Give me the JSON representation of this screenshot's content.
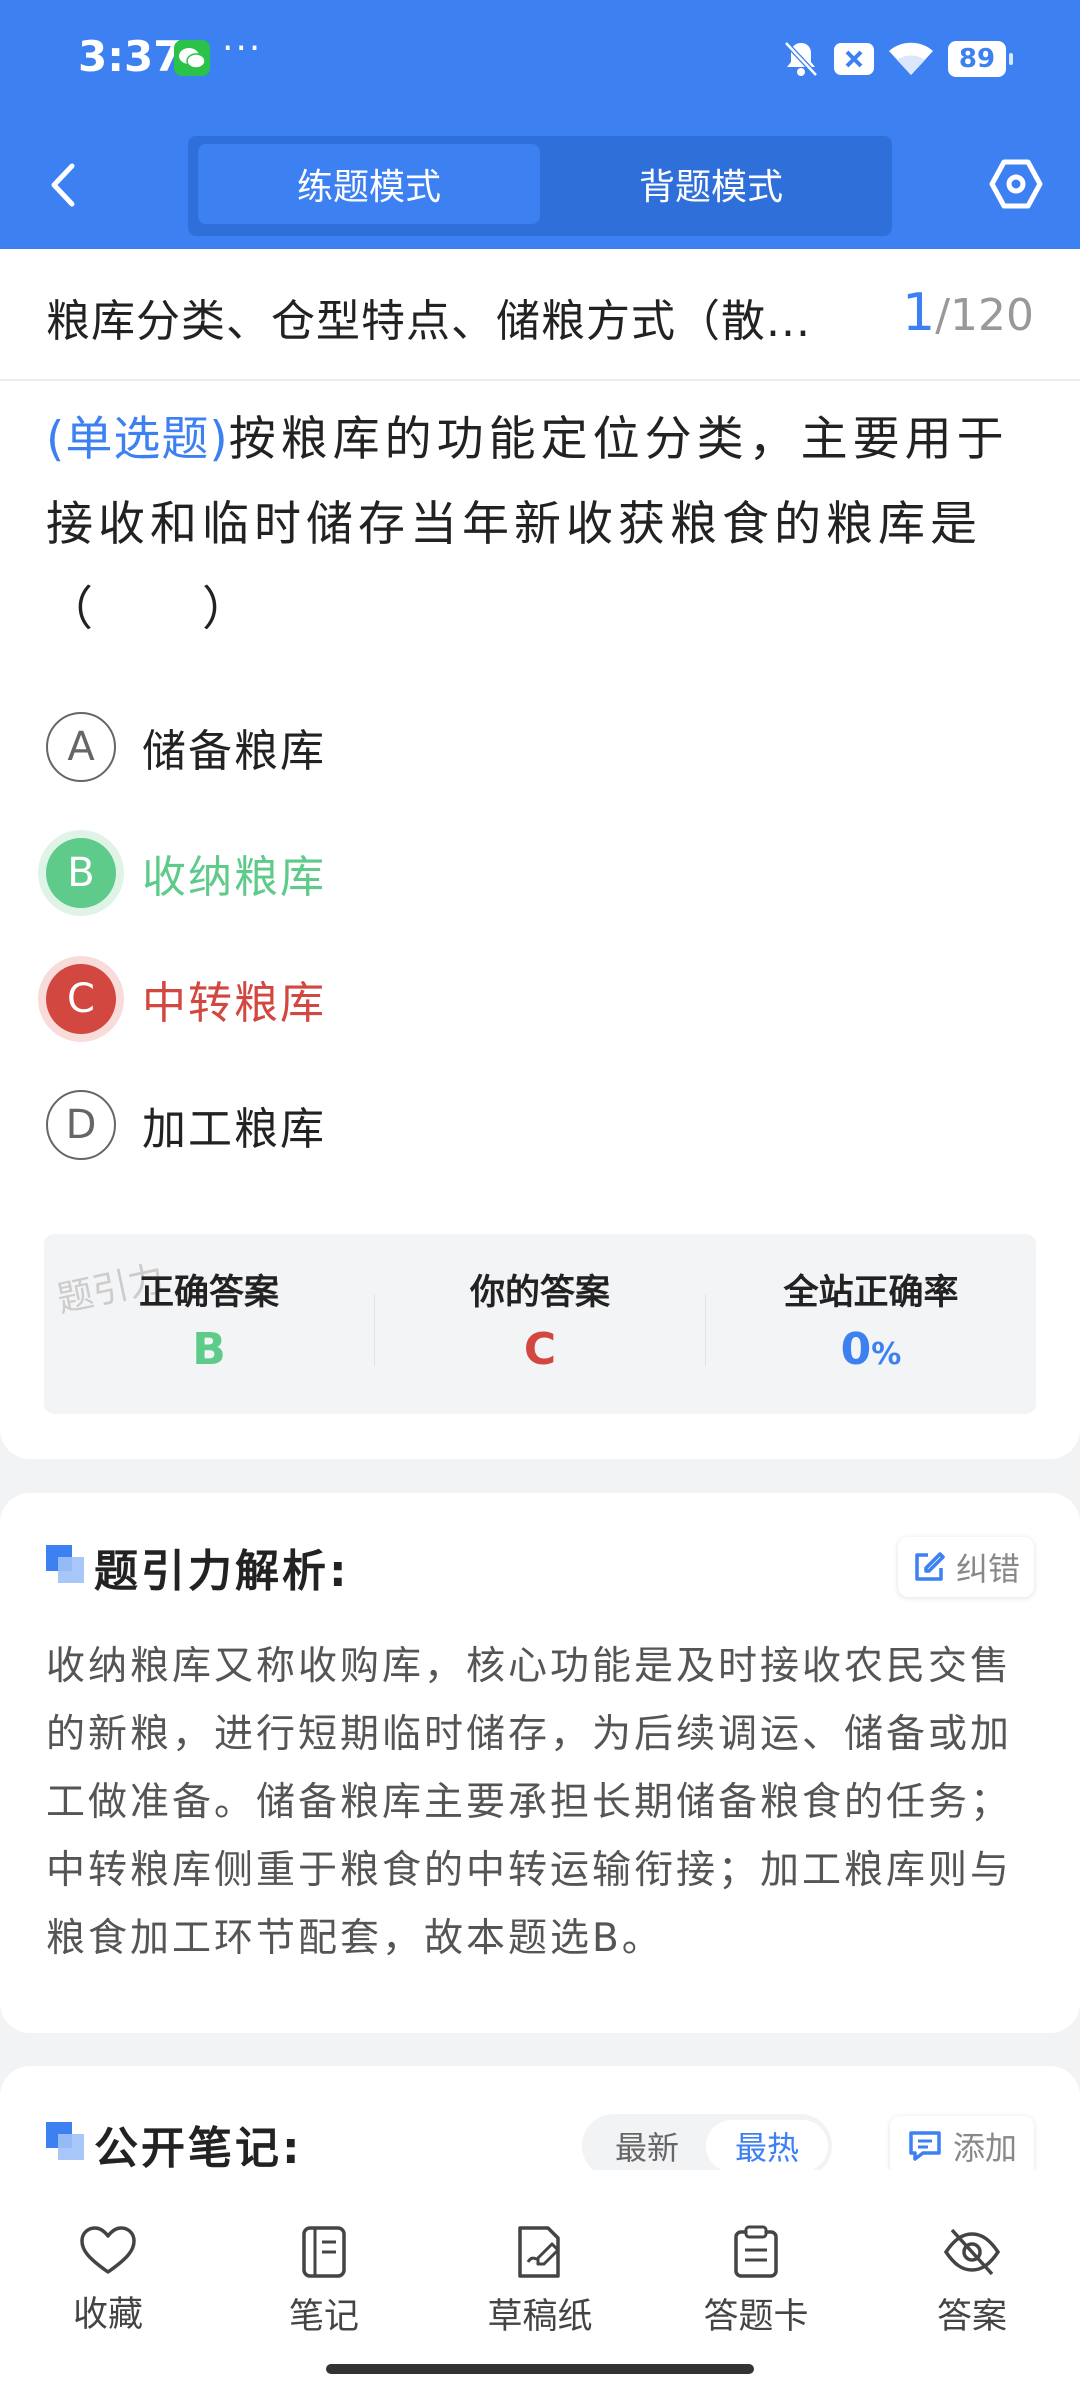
{
  "status_bar": {
    "time": "3:37",
    "more": "···",
    "battery": "89"
  },
  "header": {
    "tabs": [
      "练题模式",
      "背题模式"
    ],
    "active_tab": 0
  },
  "topic": {
    "title": "粮库分类、仓型特点、储粮方式（散...",
    "current": "1",
    "total": "/120"
  },
  "question": {
    "type": "(单选题)",
    "text": "按粮库的功能定位分类，主要用于接收和临时储存当年新收获粮食的粮库是（　　）",
    "options": [
      {
        "letter": "A",
        "text": "储备粮库",
        "state": "normal"
      },
      {
        "letter": "B",
        "text": "收纳粮库",
        "state": "correct"
      },
      {
        "letter": "C",
        "text": "中转粮库",
        "state": "wrong"
      },
      {
        "letter": "D",
        "text": "加工粮库",
        "state": "normal"
      }
    ]
  },
  "answer_summary": {
    "watermark": "题引力",
    "correct_label": "正确答案",
    "correct_value": "B",
    "yours_label": "你的答案",
    "yours_value": "C",
    "rate_label": "全站正确率",
    "rate_value": "0",
    "rate_unit": "%"
  },
  "analysis": {
    "title": "题引力解析:",
    "report_label": "纠错",
    "text": "收纳粮库又称收购库，核心功能是及时接收农民交售的新粮，进行短期临时储存，为后续调运、储备或加工做准备。储备粮库主要承担长期储备粮食的任务；中转粮库侧重于粮食的中转运输衔接；加工粮库则与粮食加工环节配套，故本题选B。"
  },
  "notes": {
    "title": "公开笔记:",
    "sort_new": "最新",
    "sort_hot": "最热",
    "add_label": "添加"
  },
  "bottom_nav": [
    "收藏",
    "笔记",
    "草稿纸",
    "答题卡",
    "答案"
  ],
  "colors": {
    "primary": "#3d80f1",
    "correct": "#5ecb8a",
    "wrong": "#d2473f"
  }
}
